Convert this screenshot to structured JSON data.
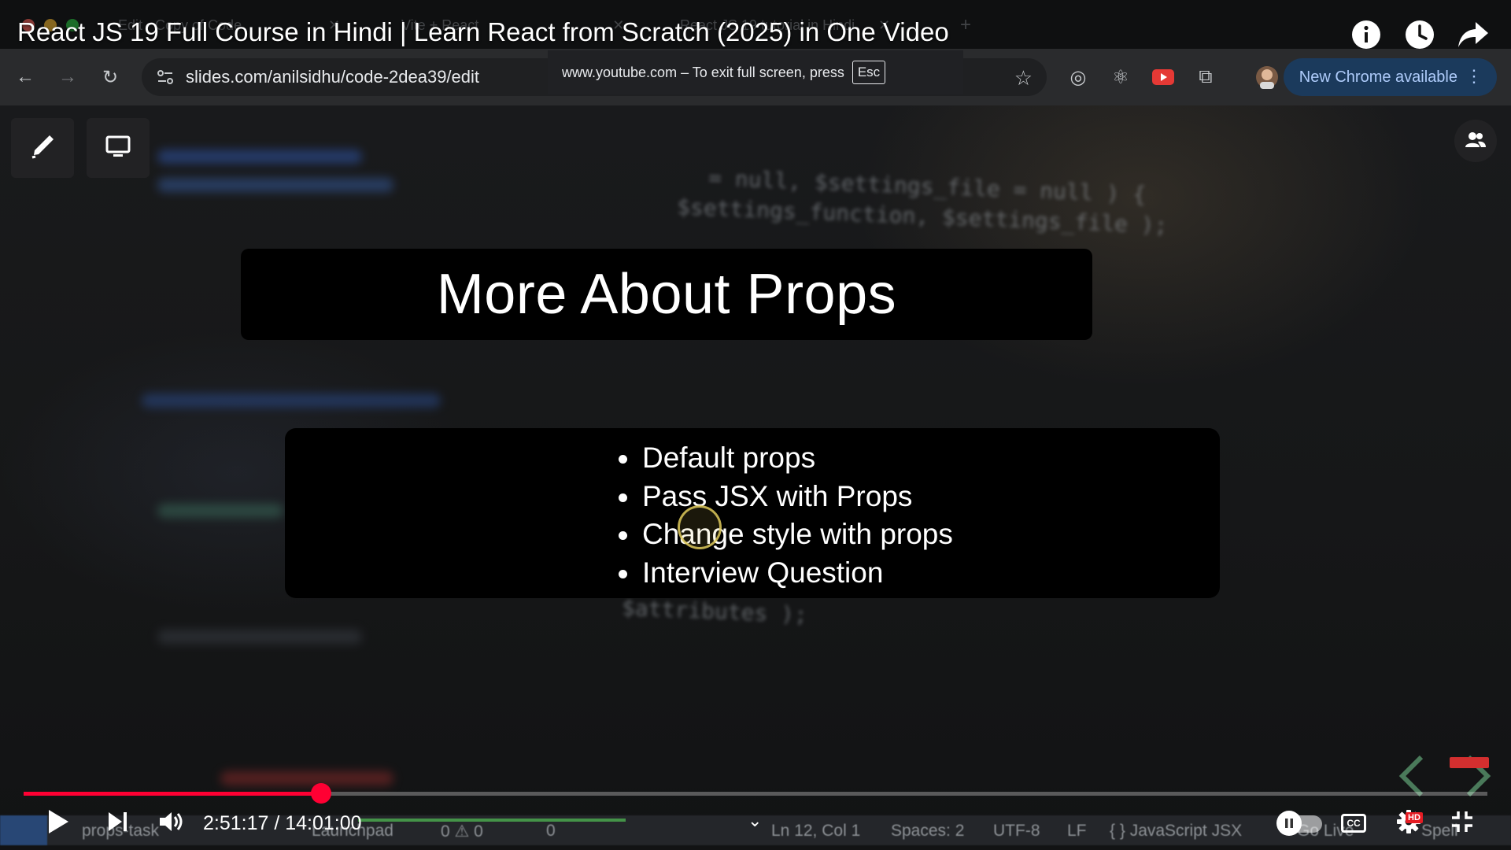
{
  "browser": {
    "tabs": [
      {
        "label": "Edit · Copy of Code"
      },
      {
        "label": "Vite + React"
      },
      {
        "label": "React JS 19 tutorial in Hindi"
      }
    ],
    "url": "slides.com/anilsidhu/code-2dea39/edit",
    "new_chrome_label": "New Chrome available",
    "fullscreen_notice": {
      "text": "www.youtube.com – To exit full screen, press",
      "key": "Esc"
    }
  },
  "video": {
    "title": "React JS 19 Full Course in Hindi | Learn React from Scratch (2025) in One Video",
    "current_time": "2:51:17",
    "duration": "14:01:00",
    "time_display": "2:51:17 / 14:01:00",
    "progress_fraction": 0.2034,
    "hd_label": "HD",
    "cc_label": "CC",
    "accent_color": "#ff0033"
  },
  "slide": {
    "title": "More About Props",
    "bullets": [
      "Default props",
      "Pass JSX with Props",
      "Change style with props",
      "Interview Question"
    ]
  },
  "background_editor": {
    "code_line_1": "= null, $settings_file = null ) {",
    "code_line_2": "$settings_function, $settings_file );",
    "code_line_3": "$attributes );",
    "status": {
      "branch": "props-task",
      "launchpad": "Launchpad",
      "problems": "0 ⚠ 0",
      "ports": "0",
      "cursor": "Ln 12, Col 1",
      "spaces": "Spaces: 2",
      "encoding": "UTF-8",
      "eol": "LF",
      "language": "{ } JavaScript JSX",
      "golive": "Go Live",
      "spell": "Spell"
    }
  }
}
